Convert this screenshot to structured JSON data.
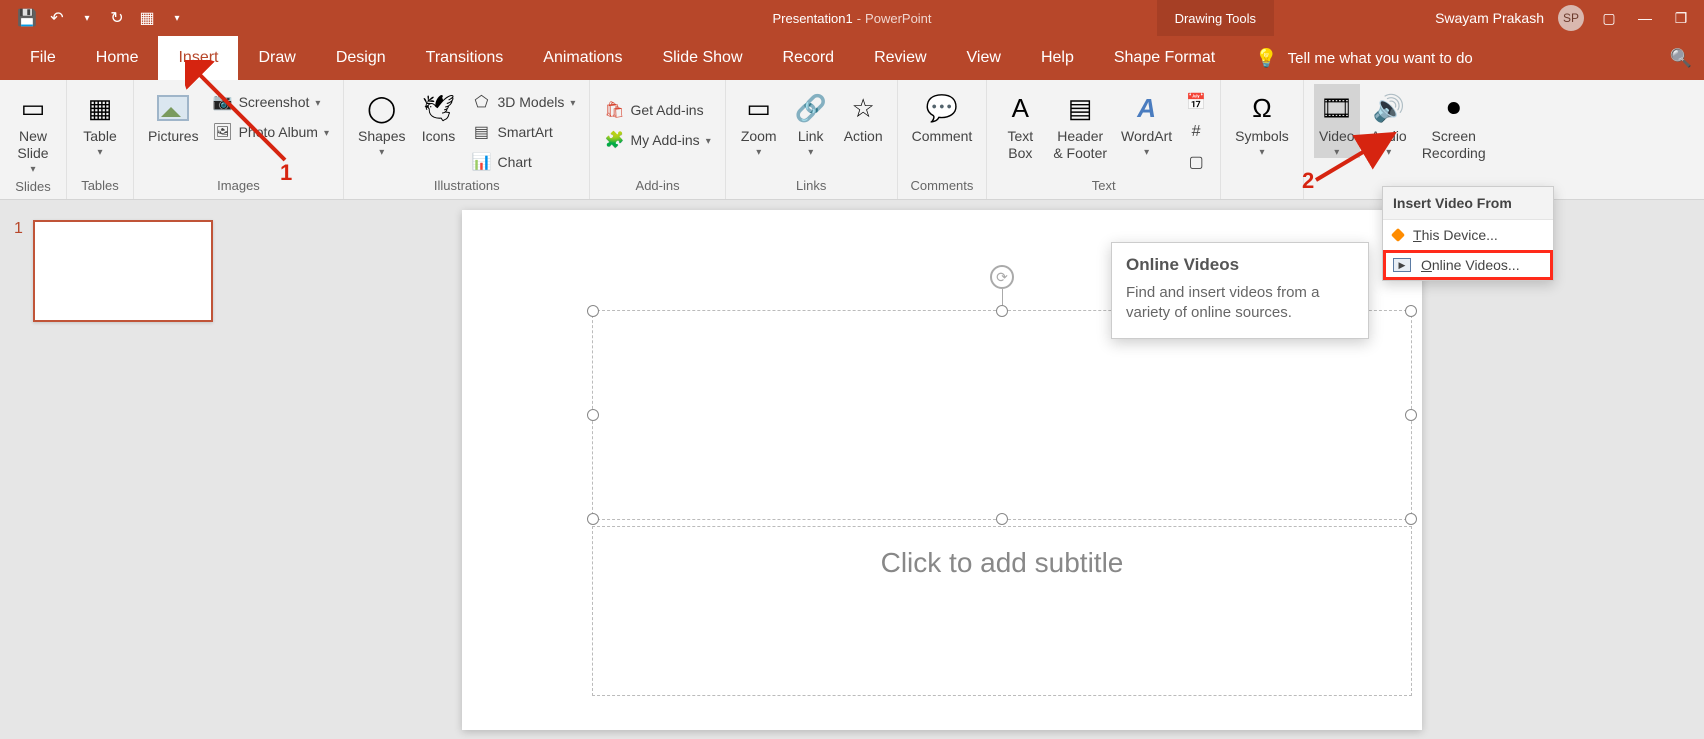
{
  "title": {
    "doc": "Presentation1",
    "sep": " - ",
    "app": "PowerPoint"
  },
  "contextTab": "Drawing Tools",
  "user": {
    "name": "Swayam Prakash",
    "initials": "SP"
  },
  "tabs": {
    "file": "File",
    "home": "Home",
    "insert": "Insert",
    "draw": "Draw",
    "design": "Design",
    "transitions": "Transitions",
    "animations": "Animations",
    "slideshow": "Slide Show",
    "record": "Record",
    "review": "Review",
    "view": "View",
    "help": "Help",
    "shapeformat": "Shape Format"
  },
  "tellme": "Tell me what you want to do",
  "ribbon": {
    "slides": {
      "newslide": "New\nSlide",
      "label": "Slides"
    },
    "tables": {
      "table": "Table",
      "label": "Tables"
    },
    "images": {
      "pictures": "Pictures",
      "screenshot": "Screenshot",
      "photoalbum": "Photo Album",
      "label": "Images"
    },
    "illustrations": {
      "shapes": "Shapes",
      "icons": "Icons",
      "models": "3D Models",
      "smartart": "SmartArt",
      "chart": "Chart",
      "label": "Illustrations"
    },
    "addins": {
      "get": "Get Add-ins",
      "my": "My Add-ins",
      "label": "Add-ins"
    },
    "links": {
      "zoom": "Zoom",
      "link": "Link",
      "action": "Action",
      "label": "Links"
    },
    "comments": {
      "comment": "Comment",
      "label": "Comments"
    },
    "text": {
      "textbox": "Text\nBox",
      "header": "Header\n& Footer",
      "wordart": "WordArt",
      "label": "Text"
    },
    "symbols": {
      "symbols": "Symbols"
    },
    "media": {
      "video": "Video",
      "audio": "Audio",
      "screen": "Screen\nRecording"
    }
  },
  "dropdown": {
    "header": "Insert Video From",
    "thisdevice": "This Device...",
    "online": "Online Videos..."
  },
  "tooltip": {
    "title": "Online Videos",
    "body": "Find and insert videos from a variety of online sources."
  },
  "slide": {
    "subtitle": "Click to add subtitle"
  },
  "thumb": {
    "num": "1"
  },
  "anno": {
    "one": "1",
    "two": "2"
  }
}
